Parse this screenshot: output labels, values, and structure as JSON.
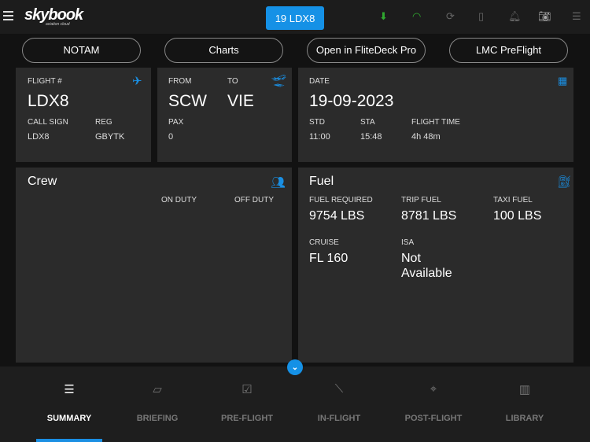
{
  "header": {
    "logo": "skybook",
    "logo_sub": "aviation cloud",
    "flight_button": "19 LDX8"
  },
  "actions": [
    "NOTAM",
    "Charts",
    "Open in FliteDeck Pro",
    "LMC PreFlight"
  ],
  "flight": {
    "label": "FLIGHT #",
    "value": "LDX8",
    "call_sign_label": "CALL SIGN",
    "call_sign": "LDX8",
    "reg_label": "REG",
    "reg": "GBYTK"
  },
  "route": {
    "from_label": "FROM",
    "from": "SCW",
    "to_label": "TO",
    "to": "VIE",
    "pax_label": "PAX",
    "pax": "0"
  },
  "date": {
    "label": "DATE",
    "value": "19-09-2023",
    "std_label": "STD",
    "std": "11:00",
    "sta_label": "STA",
    "sta": "15:48",
    "ft_label": "FLIGHT TIME",
    "ft": "4h 48m"
  },
  "crew": {
    "title": "Crew",
    "on_duty": "ON DUTY",
    "off_duty": "OFF DUTY"
  },
  "fuel": {
    "title": "Fuel",
    "req_label": "FUEL REQUIRED",
    "req": "9754 LBS",
    "trip_label": "TRIP FUEL",
    "trip": "8781 LBS",
    "taxi_label": "TAXI FUEL",
    "taxi": "100 LBS",
    "cruise_label": "CRUISE",
    "cruise": "FL 160",
    "isa_label": "ISA",
    "isa": "Not Available"
  },
  "nav": [
    {
      "label": "SUMMARY"
    },
    {
      "label": "BRIEFING"
    },
    {
      "label": "PRE-FLIGHT"
    },
    {
      "label": "IN-FLIGHT"
    },
    {
      "label": "POST-FLIGHT"
    },
    {
      "label": "LIBRARY"
    }
  ],
  "colors": {
    "accent": "#1591e6",
    "card": "#2b2b2b",
    "online": "#2fa82f"
  }
}
